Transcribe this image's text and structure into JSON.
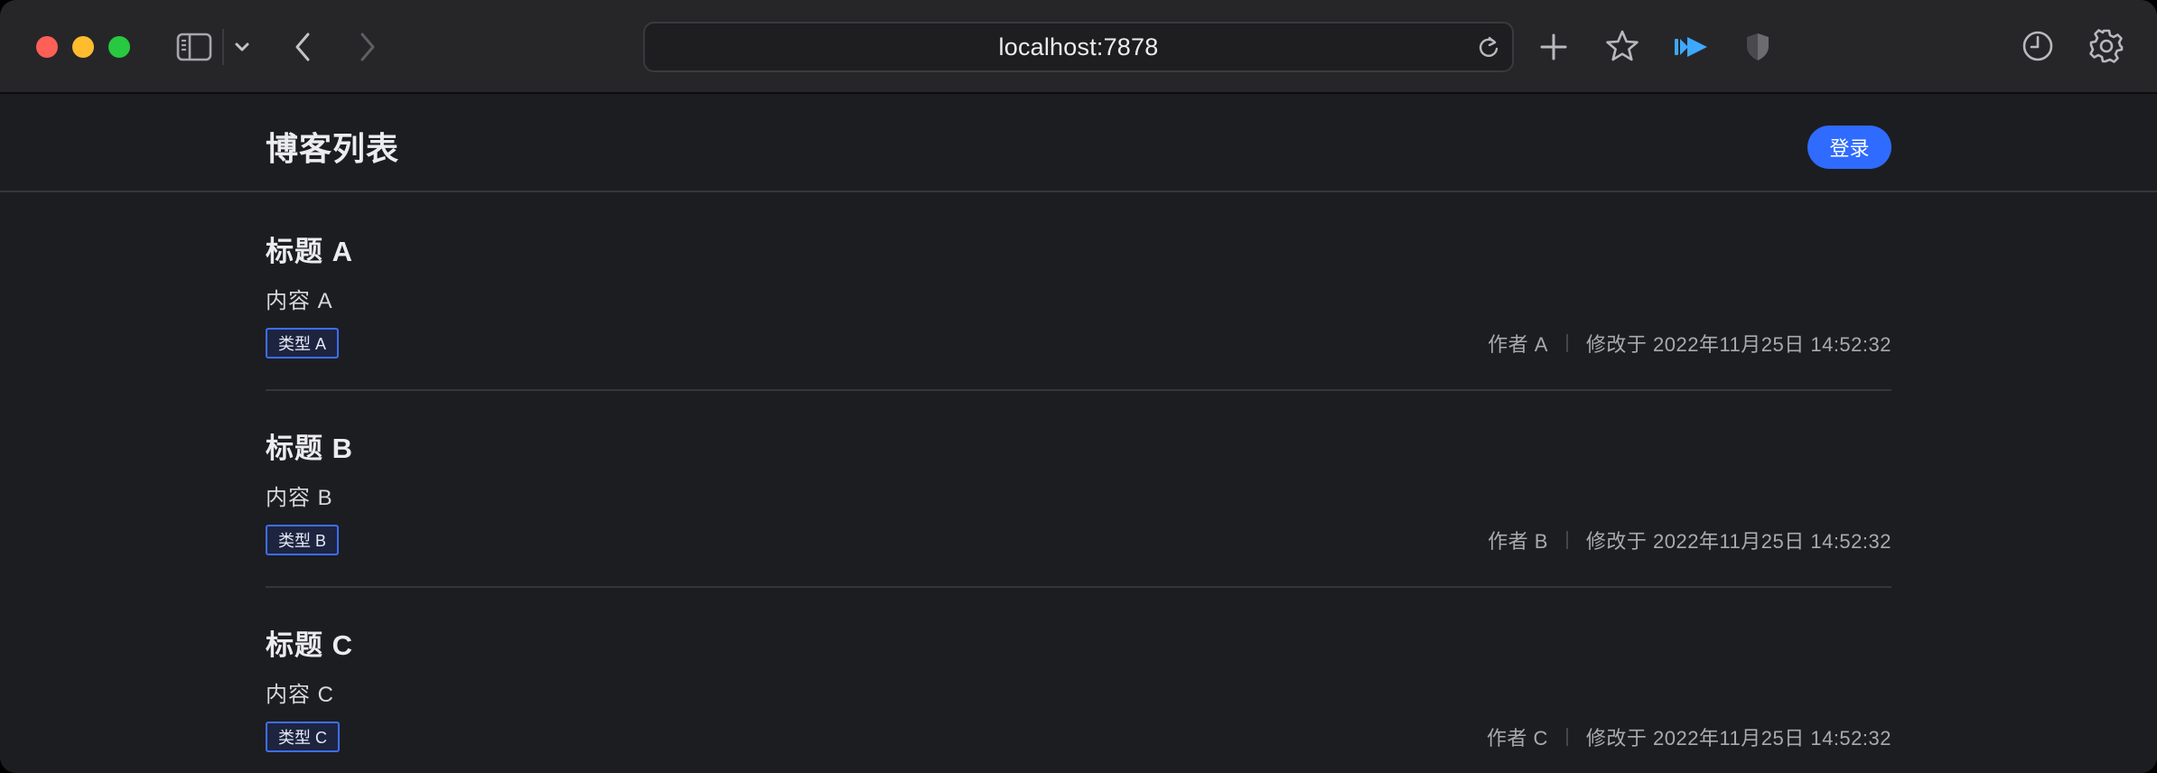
{
  "browser": {
    "url": "localhost:7878"
  },
  "page": {
    "title": "博客列表",
    "login_label": "登录"
  },
  "posts": [
    {
      "title": "标题 A",
      "content": "内容 A",
      "tag": "类型 A",
      "author": "作者 A",
      "modified": "修改于 2022年11月25日 14:52:32"
    },
    {
      "title": "标题 B",
      "content": "内容 B",
      "tag": "类型 B",
      "author": "作者 B",
      "modified": "修改于 2022年11月25日 14:52:32"
    },
    {
      "title": "标题 C",
      "content": "内容 C",
      "tag": "类型 C",
      "author": "作者 C",
      "modified": "修改于 2022年11月25日 14:52:32"
    }
  ],
  "colors": {
    "accent": "#2f6bff",
    "tag_border": "#3d6ef5",
    "background": "#1c1d21"
  }
}
